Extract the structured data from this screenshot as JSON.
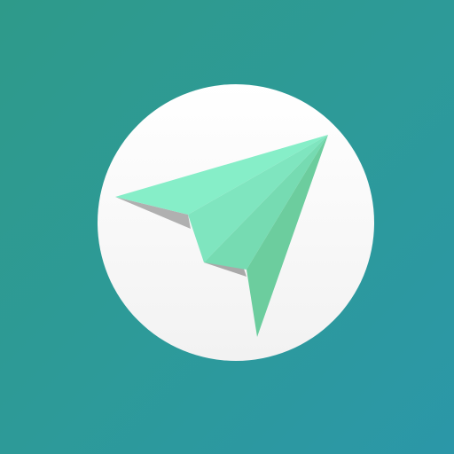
{
  "app_icon": {
    "symbol": "paper-plane-icon",
    "colors": {
      "background_start": "#2e9a8a",
      "background_end": "#2b97a8",
      "badge": "#ffffff",
      "plane_light": "#86eec8",
      "plane_mid": "#7de3bb",
      "plane_dark": "#6fcf9f",
      "plane_shadow": "#a9a9a9"
    }
  }
}
